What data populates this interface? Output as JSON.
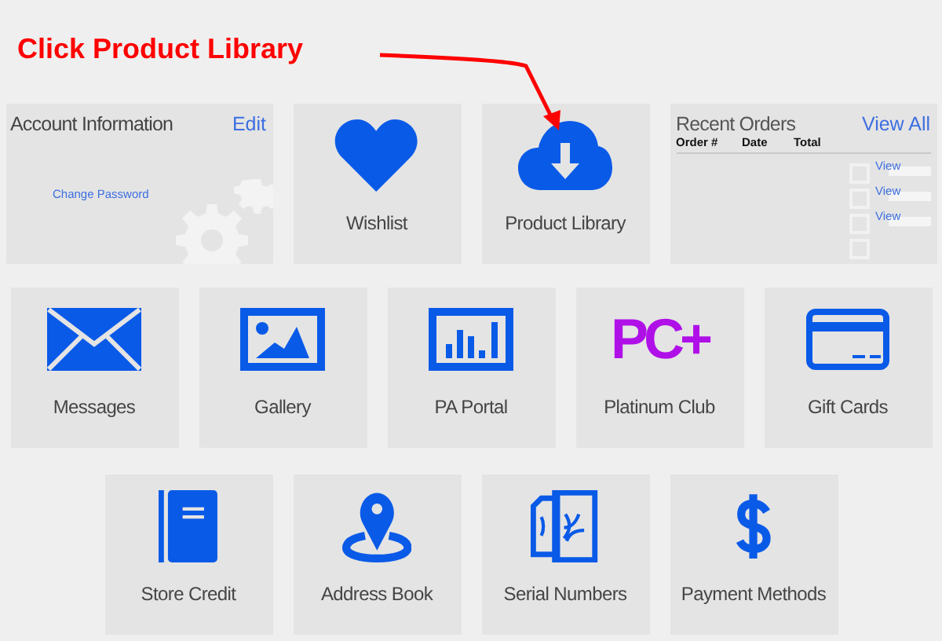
{
  "annotation": {
    "text": "Click Product Library"
  },
  "rows": [
    [
      {
        "kind": "account",
        "title": "Account Information",
        "action": "Edit",
        "link": "Change Password"
      },
      {
        "kind": "tile",
        "label": "Wishlist"
      },
      {
        "kind": "tile",
        "label": "Product Library"
      },
      {
        "kind": "orders",
        "title": "Recent Orders",
        "action": "View All",
        "columns": [
          "Order #",
          "Date",
          "Total"
        ],
        "links": [
          "View",
          "View",
          "View"
        ]
      }
    ],
    [
      {
        "kind": "tile",
        "label": "Messages"
      },
      {
        "kind": "tile",
        "label": "Gallery"
      },
      {
        "kind": "tile",
        "label": "PA Portal"
      },
      {
        "kind": "tile",
        "label": "Platinum Club",
        "logo": "PC+"
      },
      {
        "kind": "tile",
        "label": "Gift Cards"
      }
    ],
    [
      {
        "kind": "tile",
        "label": "Store Credit"
      },
      {
        "kind": "tile",
        "label": "Address Book"
      },
      {
        "kind": "tile",
        "label": "Serial Numbers"
      },
      {
        "kind": "tile",
        "label": "Payment Methods"
      }
    ]
  ]
}
